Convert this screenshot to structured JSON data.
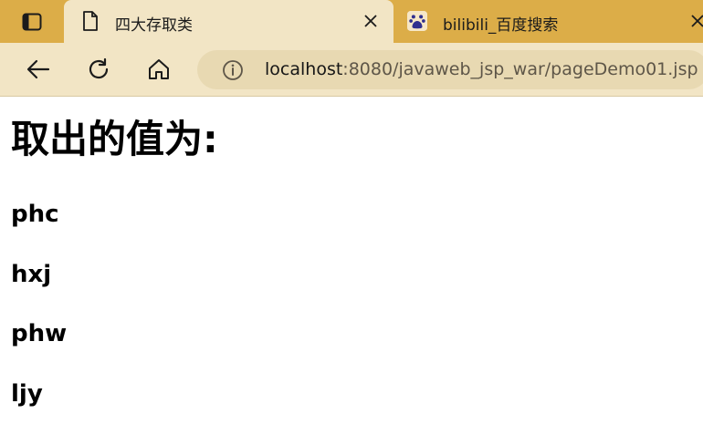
{
  "tabs": [
    {
      "title": "四大存取类",
      "active": true,
      "icon": "document-icon"
    },
    {
      "title": "bilibili_百度搜索",
      "active": false,
      "icon": "baidu-paw-icon"
    }
  ],
  "address": {
    "host": "localhost",
    "path": ":8080/javaweb_jsp_war/pageDemo01.jsp"
  },
  "page": {
    "heading": "取出的值为:",
    "values": [
      "phc",
      "hxj",
      "phw",
      "ljy"
    ]
  },
  "colors": {
    "tabstrip": "#dcad48",
    "toolbar": "#f2e5c5",
    "addressbar": "#e8d9b2"
  }
}
